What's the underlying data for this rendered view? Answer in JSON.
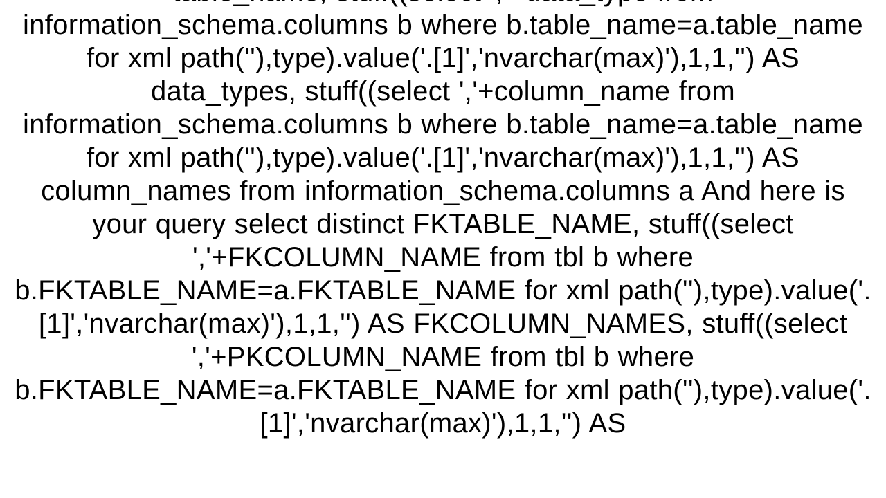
{
  "content": {
    "body_text": "table_name,   stuff((select ','+data_type    from information_schema.columns b    where b.table_name=a.table_name    for xml path(''),type).value('.[1]','nvarchar(max)'),1,1,'') AS data_types,   stuff((select ','+column_name    from information_schema.columns b    where b.table_name=a.table_name    for xml path(''),type).value('.[1]','nvarchar(max)'),1,1,'') AS column_names from information_schema.columns a  And here is your query select distinct FKTABLE_NAME,   stuff((select ','+FKCOLUMN_NAME    from tbl b    where b.FKTABLE_NAME=a.FKTABLE_NAME    for xml path(''),type).value('.[1]','nvarchar(max)'),1,1,'') AS FKCOLUMN_NAMES,   stuff((select ','+PKCOLUMN_NAME    from tbl b    where b.FKTABLE_NAME=a.FKTABLE_NAME    for xml path(''),type).value('.[1]','nvarchar(max)'),1,1,'') AS"
  }
}
